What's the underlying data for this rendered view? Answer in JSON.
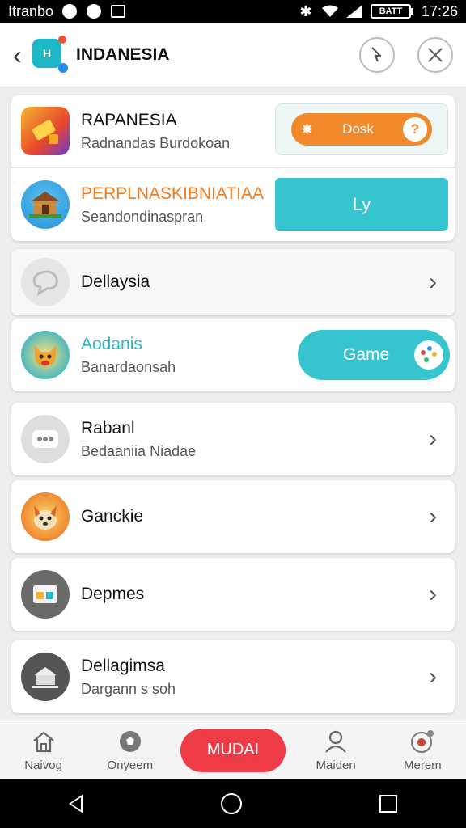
{
  "status_bar": {
    "carrier": "Itranbo",
    "time": "17:26",
    "battery_label": "BATT"
  },
  "header": {
    "title": "INDANESIA",
    "logo_text": "H"
  },
  "rows": [
    {
      "title": "RAPANESIA",
      "subtitle": "Radnandas Burdokoan",
      "title_color": "#111111"
    },
    {
      "title": "PERPLNASKIBNIATIAA",
      "subtitle": "Seandondinaspran",
      "title_color": "#f07a1e"
    },
    {
      "title": "Dellaysia",
      "subtitle": ""
    },
    {
      "title": "Aodanis",
      "subtitle": "Banardaonsah",
      "title_color": "#2ab8c4"
    },
    {
      "title": "Rabanl",
      "subtitle": "Bedaaniia Niadae"
    },
    {
      "title": "Ganckie",
      "subtitle": ""
    },
    {
      "title": "Depmes",
      "subtitle": ""
    },
    {
      "title": "Dellagimsa",
      "subtitle": "Dargann s soh"
    }
  ],
  "buttons": {
    "orange_pill": "Dosk",
    "teal": "Ly",
    "game": "Game"
  },
  "bottom_nav": {
    "item1": "Naivog",
    "item2": "Onyeem",
    "main": "MUDAI",
    "item4": "Maiden",
    "item5": "Merem"
  },
  "icons": {
    "back": "chevron-left-icon",
    "search": "search-icon",
    "close": "close-icon"
  },
  "colors": {
    "accent_teal": "#36c4cf",
    "accent_orange": "#f28a2c",
    "accent_red": "#ee3b45"
  }
}
